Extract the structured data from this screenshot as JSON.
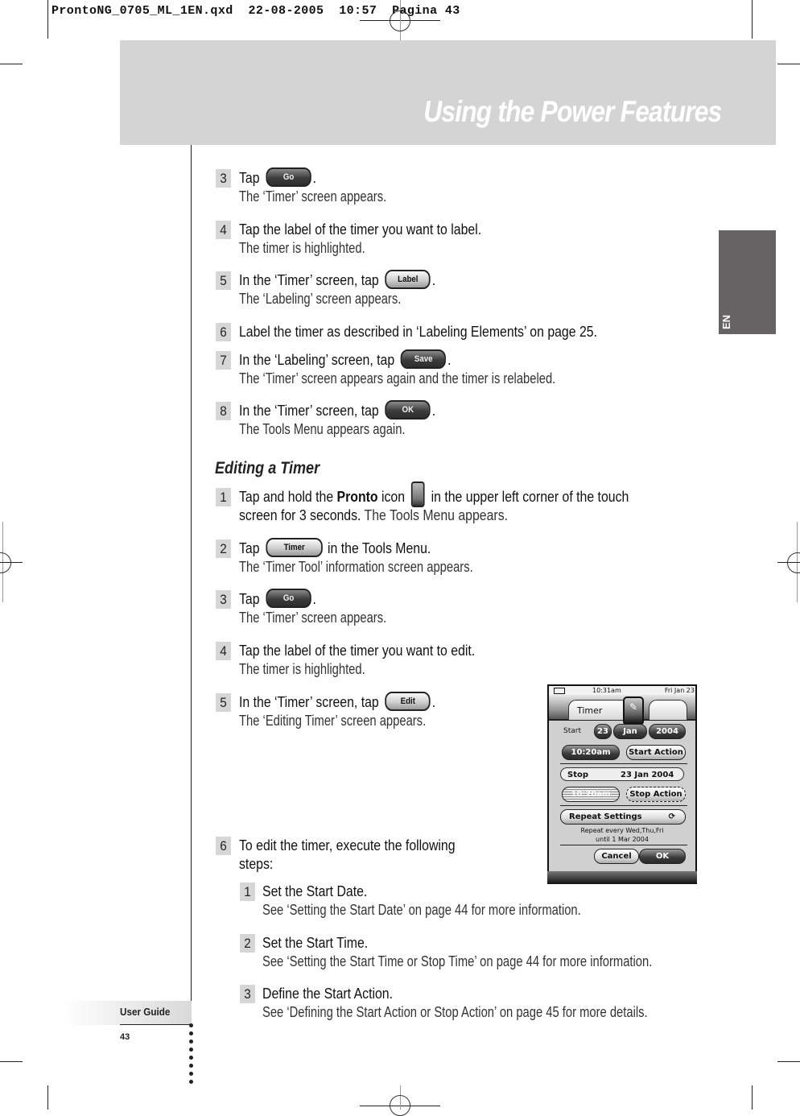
{
  "slug": "ProntoNG_0705_ML_1EN.qxd  22-08-2005  10:57  Pagina 43",
  "header": {
    "title": "Using the Power Features"
  },
  "lang_tab": "EN",
  "footer": {
    "label": "User Guide",
    "page": "43"
  },
  "steps_top": [
    {
      "num": "3",
      "parts": [
        {
          "t": "Tap "
        },
        {
          "btn": "Go",
          "style": "dark"
        },
        {
          "t": "."
        }
      ],
      "desc": "The ‘Timer’ screen appears."
    },
    {
      "num": "4",
      "parts": [
        {
          "t": "Tap the label of the timer you want to label."
        }
      ],
      "desc": "The timer is highlighted."
    },
    {
      "num": "5",
      "parts": [
        {
          "t": "In the ‘Timer’ screen, tap "
        },
        {
          "btn": "Label",
          "style": "light"
        },
        {
          "t": "."
        }
      ],
      "desc": "The ‘Labeling’ screen appears."
    },
    {
      "num": "6",
      "parts": [
        {
          "t": "Label the timer as described in ‘Labeling Elements’ on page 25."
        }
      ],
      "desc": ""
    },
    {
      "num": "7",
      "parts": [
        {
          "t": "In the ‘Labeling’ screen, tap "
        },
        {
          "btn": "Save",
          "style": "dark"
        },
        {
          "t": "."
        }
      ],
      "desc": "The ‘Timer’ screen appears again and the timer is relabeled."
    },
    {
      "num": "8",
      "parts": [
        {
          "t": "In the ‘Timer’ screen, tap "
        },
        {
          "btn": "OK",
          "style": "dark"
        },
        {
          "t": "."
        }
      ],
      "desc": "The Tools Menu appears again."
    }
  ],
  "section": {
    "title": "Editing a Timer"
  },
  "steps_edit": [
    {
      "num": "1",
      "line1_parts": [
        {
          "t": "Tap and hold the "
        },
        {
          "b": "Pronto"
        },
        {
          "t": " icon "
        },
        {
          "icon": "pronto-icon"
        },
        {
          "t": " in the upper left corner of the touch"
        }
      ],
      "line2_parts": [
        {
          "t": "screen for 3 seconds. ",
          "bold": false
        },
        {
          "light": "The Tools Menu appears."
        }
      ]
    },
    {
      "num": "2",
      "parts": [
        {
          "t": "Tap "
        },
        {
          "btn": "Timer",
          "style": "light",
          "wide": true
        },
        {
          "t": " in the Tools Menu."
        }
      ],
      "desc": "The ‘Timer Tool’ information screen appears."
    },
    {
      "num": "3",
      "parts": [
        {
          "t": "Tap "
        },
        {
          "btn": "Go",
          "style": "dark"
        },
        {
          "t": "."
        }
      ],
      "desc": "The ‘Timer’ screen appears."
    },
    {
      "num": "4",
      "parts": [
        {
          "t": "Tap the label of the timer you want to edit."
        }
      ],
      "desc": "The timer is highlighted."
    },
    {
      "num": "5",
      "parts": [
        {
          "t": "In the ‘Timer’ screen, tap "
        },
        {
          "btn": "Edit",
          "style": "light"
        },
        {
          "t": "."
        }
      ],
      "desc": "The ‘Editing Timer’ screen appears."
    },
    {
      "num": "6",
      "parts": [
        {
          "t": "To edit the timer, execute the following"
        }
      ],
      "desc": "steps:"
    }
  ],
  "substeps": [
    {
      "num": "1",
      "title": "Set the Start Date.",
      "desc": "See ‘Setting the Start Date’ on page 44 for more information."
    },
    {
      "num": "2",
      "title": "Set the Start Time.",
      "desc": "See ‘Setting the Start Time or Stop Time’ on page 44 for more information."
    },
    {
      "num": "3",
      "title": "Define the Start Action.",
      "desc": "See ‘Defining the Start Action or Stop Action’ on page 45 for more details."
    }
  ],
  "device": {
    "status_time": "10:31am",
    "status_date": "Fri Jan 23",
    "tab_title": "Timer",
    "start_label": "Start",
    "start_day": "23",
    "start_month": "Jan",
    "start_year": "2004",
    "start_time": "10:20am",
    "start_action": "Start Action",
    "stop_label": "Stop",
    "stop_date": "23 Jan 2004",
    "stop_time": "10:20am",
    "stop_action": "Stop Action",
    "repeat_label": "Repeat Settings",
    "repeat_line1": "Repeat every Wed,Thu,Fri",
    "repeat_line2": "until 1 Mar 2004",
    "cancel": "Cancel",
    "ok": "OK"
  }
}
